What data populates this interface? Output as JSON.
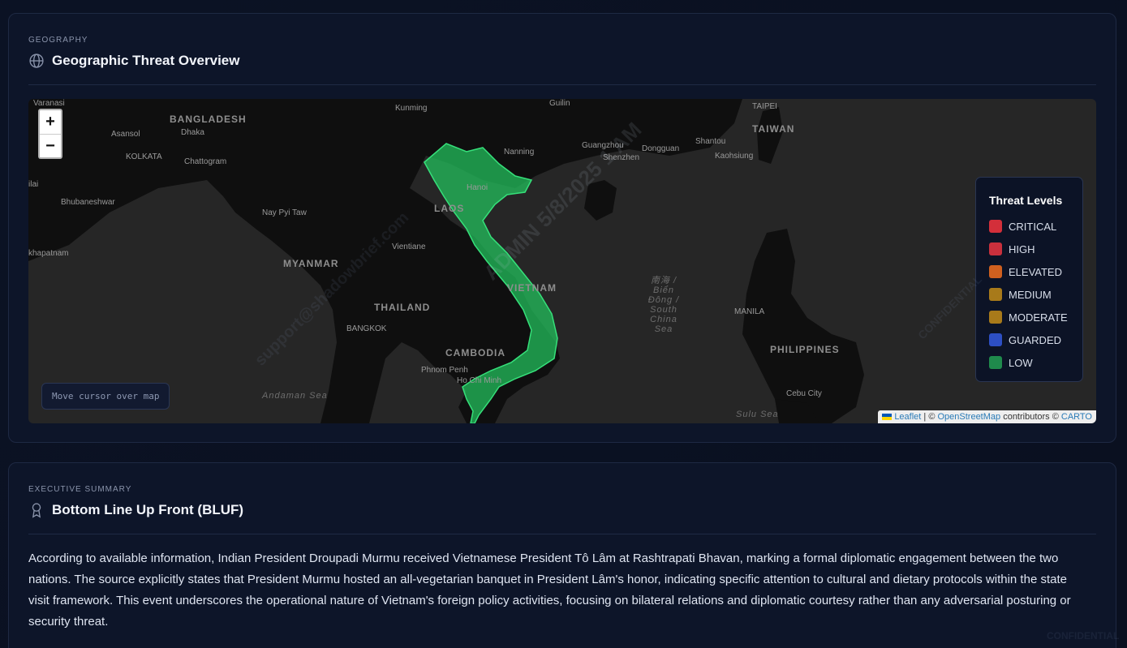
{
  "geo": {
    "eyebrow": "GEOGRAPHY",
    "title": "Geographic Threat Overview",
    "title_icon": "globe-icon",
    "zoom_in": "+",
    "zoom_out": "−",
    "coords_text": "Move cursor over map",
    "legend": {
      "title": "Threat Levels",
      "items": [
        {
          "label": "CRITICAL",
          "color": "#d32f3a"
        },
        {
          "label": "HIGH",
          "color": "#c9303d"
        },
        {
          "label": "ELEVATED",
          "color": "#d0601f"
        },
        {
          "label": "MEDIUM",
          "color": "#a87a1a"
        },
        {
          "label": "MODERATE",
          "color": "#a87a1a"
        },
        {
          "label": "GUARDED",
          "color": "#2d4fc4"
        },
        {
          "label": "LOW",
          "color": "#1f8a4c"
        }
      ]
    },
    "highlight_color": "#22c55e",
    "attribution": {
      "leaflet": "Leaflet",
      "sep": " | © ",
      "osm": "OpenStreetMap",
      "contrib": " contributors © ",
      "carto": "CARTO"
    },
    "map_labels": {
      "cities": [
        "Varanasi",
        "Kunming",
        "Guilin",
        "TAIPEI",
        "Asansol",
        "Dhaka",
        "KOLKATA",
        "Chattogram",
        "Guangzhou",
        "Dongguan",
        "Shantou",
        "Shenzhen",
        "Kaohsiung",
        "Bhubaneshwar",
        "Hanoi",
        "Nay Pyi Taw",
        "Vientiane",
        "BANGKOK",
        "Phnom Penh",
        "Ho Chi Minh",
        "MANILA",
        "Cebu City",
        "Nanning",
        "khapatnam",
        "ilai"
      ],
      "countries": [
        "BANGLADESH",
        "TAIWAN",
        "LAOS",
        "MYANMAR",
        "THAILAND",
        "CAMBODIA",
        "VIETNAM",
        "PHILIPPINES"
      ],
      "seas": [
        "Andaman Sea",
        "南海 / Biển Đông / South China Sea",
        "Sulu Sea"
      ]
    }
  },
  "summary": {
    "eyebrow": "EXECUTIVE SUMMARY",
    "title": "Bottom Line Up Front (BLUF)",
    "title_icon": "award-icon",
    "text": "According to available information, Indian President Droupadi Murmu received Vietnamese President Tô Lâm at Rashtrapati Bhavan, marking a formal diplomatic engagement between the two nations. The source explicitly states that President Murmu hosted an all-vegetarian banquet in President Lâm's honor, indicating specific attention to cultural and dietary protocols within the state visit framework. This event underscores the operational nature of Vietnam's foreign policy activities, focusing on bilateral relations and diplomatic courtesy rather than any adversarial posturing or security threat."
  },
  "watermarks": {
    "email": "support@shadowbrief.com",
    "stamp": "ADMIN 5/8/2025 1 AM",
    "conf": "CONFIDENTIAL"
  }
}
